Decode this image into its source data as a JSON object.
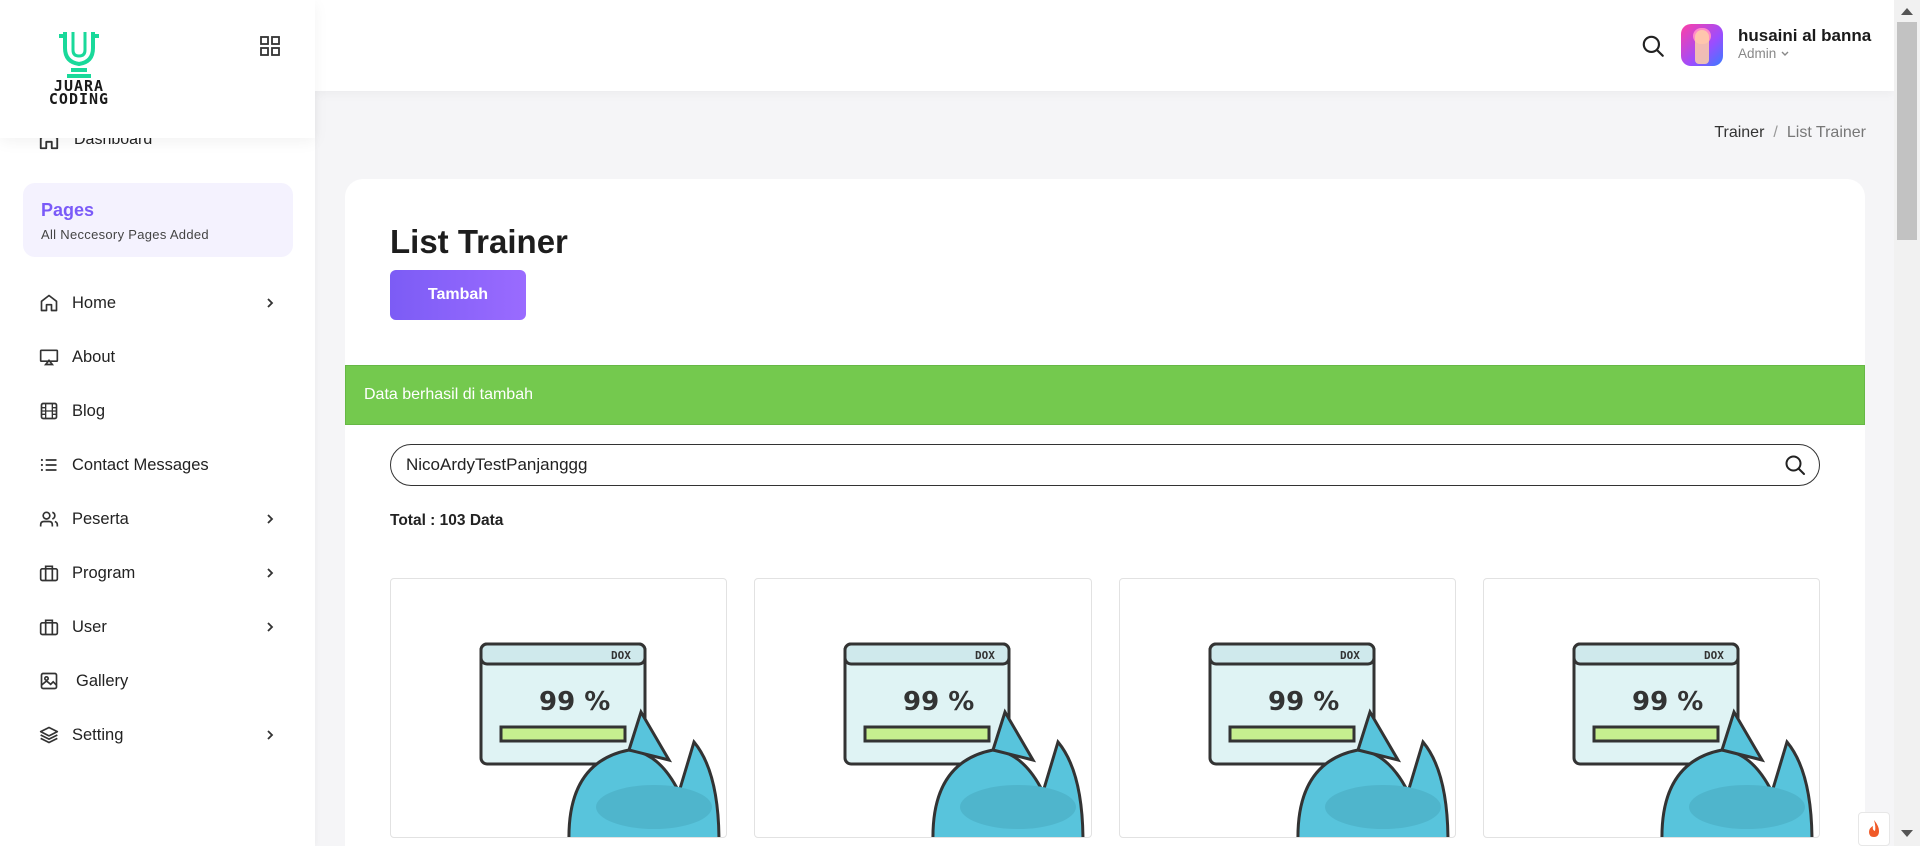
{
  "brand": {
    "logo_text_line1": "JUARA",
    "logo_text_line2": "CODING",
    "accent": "#19d99a"
  },
  "sidebar": {
    "dashboard_label": "Dashboard",
    "pages_card": {
      "title": "Pages",
      "subtitle": "All Neccesory Pages Added"
    },
    "items": [
      {
        "label": "Home",
        "icon": "home-icon",
        "has_submenu": true
      },
      {
        "label": "About",
        "icon": "monitor-icon",
        "has_submenu": false
      },
      {
        "label": "Blog",
        "icon": "film-icon",
        "has_submenu": false
      },
      {
        "label": "Contact Messages",
        "icon": "list-icon",
        "has_submenu": false
      },
      {
        "label": "Peserta",
        "icon": "users-icon",
        "has_submenu": true
      },
      {
        "label": "Program",
        "icon": "briefcase-icon",
        "has_submenu": true
      },
      {
        "label": "User",
        "icon": "briefcase-icon",
        "has_submenu": true
      },
      {
        "label": "Gallery",
        "icon": "image-icon",
        "has_submenu": false
      },
      {
        "label": "Setting",
        "icon": "layers-icon",
        "has_submenu": true
      }
    ]
  },
  "header": {
    "user_name": "husaini al banna",
    "user_role": "Admin"
  },
  "breadcrumb": {
    "parent": "Trainer",
    "separator": "/",
    "current": "List Trainer"
  },
  "main": {
    "title": "List Trainer",
    "add_button": "Tambah",
    "alert_text": "Data berhasil di tambah",
    "alert_color": "#74c94e",
    "search_value": "NicoArdyTestPanjanggg",
    "total_text": "Total : 103 Data",
    "cards": [
      {
        "placeholder_text": "99 %",
        "window_label": "DOX"
      },
      {
        "placeholder_text": "99 %",
        "window_label": "DOX"
      },
      {
        "placeholder_text": "99 %",
        "window_label": "DOX"
      },
      {
        "placeholder_text": "99 %",
        "window_label": "DOX"
      }
    ]
  },
  "colors": {
    "primary": "#7c5cf5",
    "success": "#74c94e",
    "background": "#f5f5f7"
  }
}
